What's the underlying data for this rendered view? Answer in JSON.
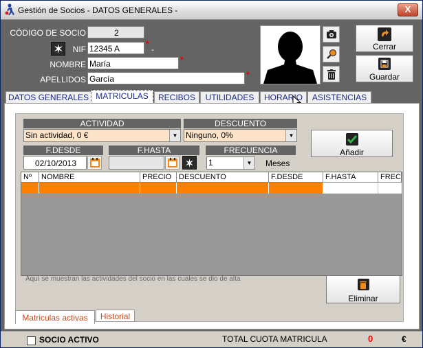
{
  "window": {
    "title": "Gestión de Socios - DATOS GENERALES -",
    "close_label": "X"
  },
  "form": {
    "codigo_label": "CÓDIGO DE SOCIO",
    "codigo_value": "2",
    "nif_label": "NIF",
    "nif_value": "12345 A",
    "nif_suffix": "-",
    "nombre_label": "NOMBRE",
    "nombre_value": "María",
    "apellidos_label": "APELLIDOS",
    "apellidos_value": "García",
    "required_mark": "*"
  },
  "buttons": {
    "cerrar": "Cerrar",
    "guardar": "Guardar",
    "anadir": "Añadir",
    "eliminar": "Eliminar"
  },
  "tabs": [
    {
      "label": "DATOS GENERALES"
    },
    {
      "label": "MATRICULAS"
    },
    {
      "label": "RECIBOS"
    },
    {
      "label": "UTILIDADES"
    },
    {
      "label": "HORARIO"
    },
    {
      "label": "ASISTENCIAS"
    }
  ],
  "matriculas": {
    "actividad_header": "ACTIVIDAD",
    "actividad_value": "Sin actividad, 0 €",
    "descuento_header": "DESCUENTO",
    "descuento_value": "Ninguno, 0%",
    "fdesde_header": "F.DESDE",
    "fdesde_value": "02/10/2013",
    "fhasta_header": "F.HASTA",
    "fhasta_value": "",
    "frecuencia_header": "FRECUENCIA",
    "frecuencia_value": "1",
    "meses_label": "Meses",
    "grid_columns": [
      "Nº",
      "NOMBRE",
      "PRECIO",
      "DESCUENTO",
      "F.DESDE",
      "F.HASTA",
      "FREC"
    ],
    "hint": "Aquí se muestran las actividades del socio en las cuales se dio de alta"
  },
  "subtabs": [
    {
      "label": "Matriculas activas"
    },
    {
      "label": "Historial"
    }
  ],
  "status": {
    "socio_activo": "SOCIO ACTIVO",
    "total_label": "TOTAL CUOTA MATRICULA",
    "total_value": "0",
    "currency": "€"
  },
  "colors": {
    "accent_orange": "#ff8000",
    "required_red": "#ee0000",
    "field_peach": "#fde3c8",
    "tab_text": "#1a2a8a"
  }
}
